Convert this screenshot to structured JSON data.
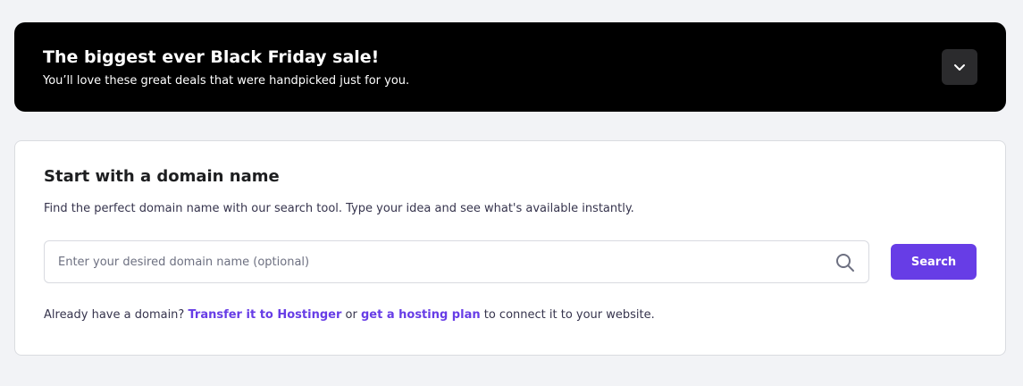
{
  "banner": {
    "title": "The biggest ever Black Friday sale!",
    "subtitle": "You’ll love these great deals that were handpicked just for you.",
    "toggle_icon": "chevron-down-icon"
  },
  "domain_card": {
    "title": "Start with a domain name",
    "description": "Find the perfect domain name with our search tool. Type your idea and see what's available instantly.",
    "search": {
      "value": "",
      "placeholder": "Enter your desired domain name (optional)",
      "icon": "search-icon",
      "button_label": "Search"
    },
    "footer": {
      "prefix": "Already have a domain?",
      "transfer_link": "Transfer it to Hostinger",
      "middle": "or",
      "hosting_link": "get a hosting plan",
      "suffix": "to connect it to your website."
    }
  },
  "colors": {
    "background": "#f2f3f6",
    "banner_bg": "#000000",
    "accent": "#673de6",
    "text": "#1d1e20"
  }
}
